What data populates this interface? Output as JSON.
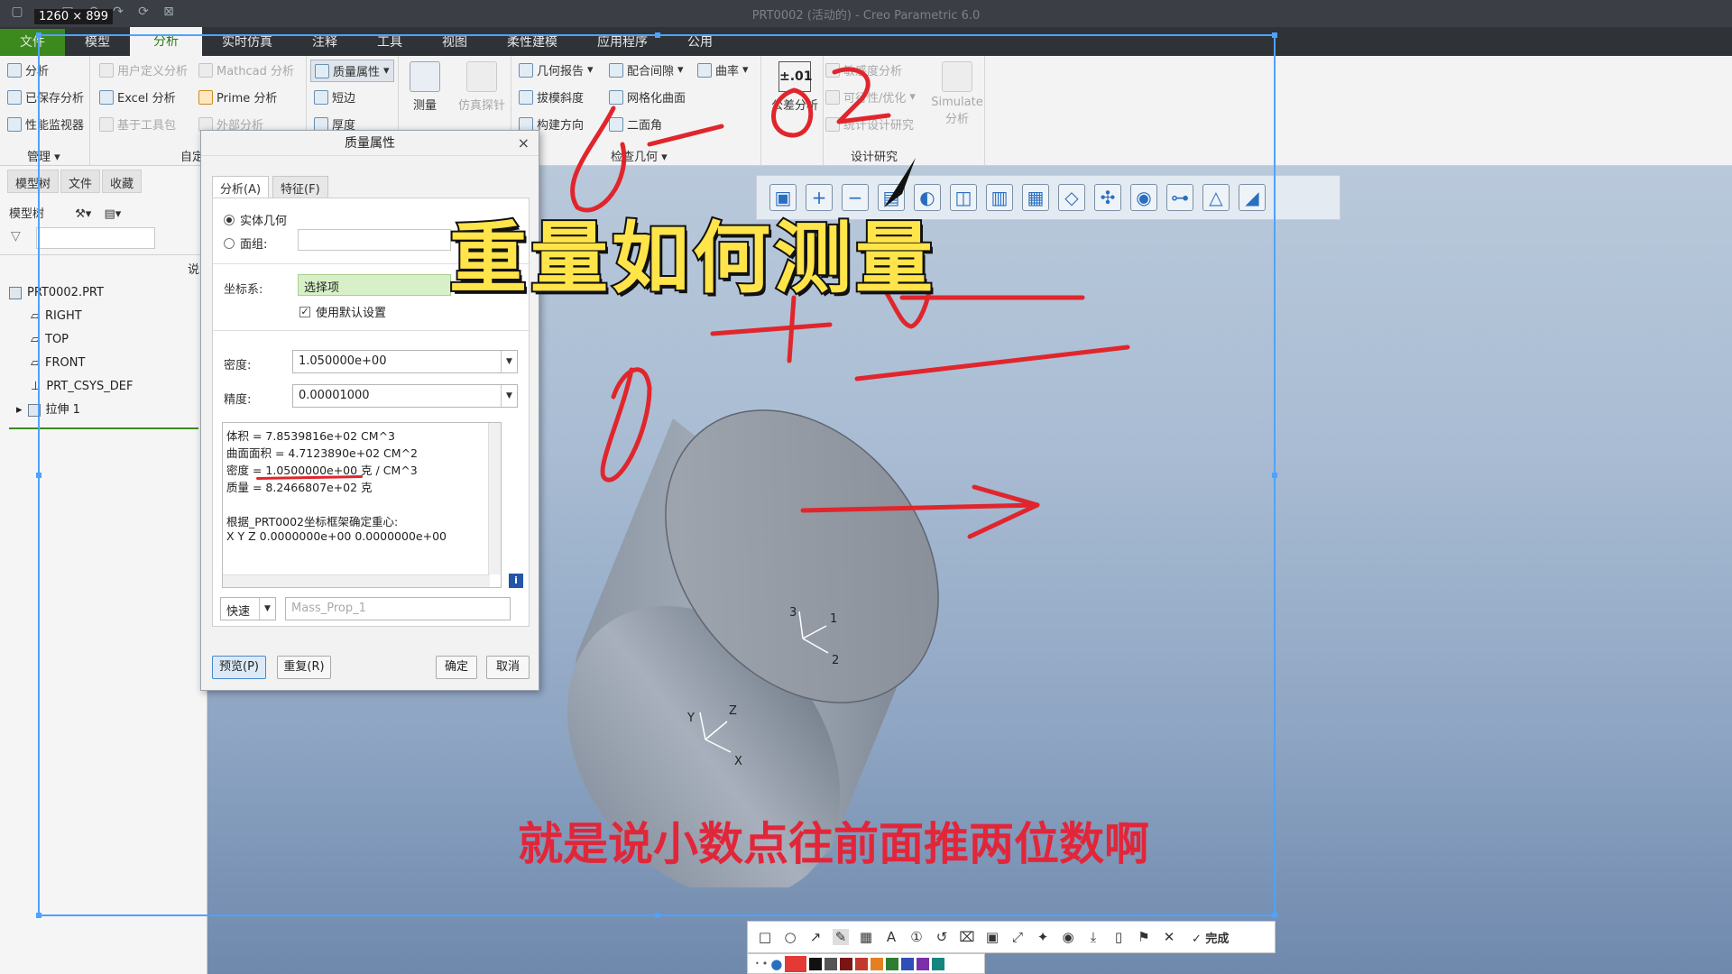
{
  "window": {
    "size_badge": "1260 × 899",
    "title": "PRT0002 (活动的) - Creo Parametric 6.0"
  },
  "tabs": [
    "文件",
    "模型",
    "分析",
    "实时仿真",
    "注释",
    "工具",
    "视图",
    "柔性建模",
    "应用程序",
    "公用"
  ],
  "active_tab": "分析",
  "ribbon": {
    "manage": {
      "items": [
        "分析",
        "已保存分析",
        "性能监视器"
      ],
      "label": "管理"
    },
    "custom": {
      "items": [
        "用户定义分析",
        "Mathcad 分析",
        "Excel 分析",
        "Prime 分析",
        "基于工具包",
        "外部分析"
      ],
      "label": "自定"
    },
    "model_report": {
      "items": [
        "质量属性",
        "短边",
        "厚度"
      ]
    },
    "measure": {
      "label": "测量"
    },
    "sim_probe": {
      "label": "仿真探针"
    },
    "inspect_geometry": {
      "items": [
        "几何报告",
        "配合间隙",
        "曲率",
        "拔模斜度",
        "网格化曲面",
        "构建方向",
        "二面角"
      ],
      "label": "检查几何"
    },
    "tolerance": {
      "icon_text": "±.01",
      "label": "公差分析"
    },
    "design_study": {
      "items": [
        "敏感度分析",
        "可行性/优化",
        "统计设计研究"
      ],
      "simulate": "Simulate 分析",
      "label": "设计研究"
    }
  },
  "left_panel": {
    "tabs": [
      "模型树",
      "文件",
      "收藏"
    ],
    "toolbar_label": "模型树",
    "column_label": "说",
    "tree": [
      {
        "label": "PRT0002.PRT",
        "indent": 0
      },
      {
        "label": "RIGHT",
        "indent": 1
      },
      {
        "label": "TOP",
        "indent": 1
      },
      {
        "label": "FRONT",
        "indent": 1
      },
      {
        "label": "PRT_CSYS_DEF",
        "indent": 1
      },
      {
        "label": "拉伸 1",
        "indent": 1
      }
    ]
  },
  "dialog": {
    "title": "质量属性",
    "tabs": [
      "分析(A)",
      "特征(F)"
    ],
    "active_tab": "分析(A)",
    "radio_solid": "实体几何",
    "radio_quilt": "面组:",
    "csys_label": "坐标系:",
    "csys_value": "选择项",
    "use_default": "使用默认设置",
    "density_label": "密度:",
    "density_value": "1.050000e+00",
    "accuracy_label": "精度:",
    "accuracy_value": "0.00001000",
    "results": [
      "体积 =  7.8539816e+02  CM^3",
      "曲面面积 =  4.7123890e+02  CM^2",
      "密度 =  1.0500000e+00 克 / CM^3",
      "质量 =  8.2466807e+02 克",
      "",
      "根据_PRT0002坐标框架确定重心:",
      "X   Y   Z     0.0000000e+00   0.0000000e+00"
    ],
    "mode": "快速",
    "name_placeholder": "Mass_Prop_1",
    "preview": "预览(P)",
    "repeat": "重复(R)",
    "ok": "确定",
    "cancel": "取消"
  },
  "overlay": {
    "title": "重量如何测量",
    "subtitle": "就是说小数点往前面推两位数啊",
    "title_color": "#ffe44a",
    "subtitle_color": "#e2263a"
  },
  "annotation_toolbar": {
    "tools": [
      "□",
      "○",
      "↗",
      "✎",
      "▦",
      "A",
      "①",
      "↺",
      "⌧",
      "▣",
      "⤢",
      "✦",
      "◉",
      "⤓",
      "▯",
      "⚑",
      "✕"
    ],
    "done": "完成",
    "colors": [
      "#e53935",
      "#111111",
      "#555555",
      "#7b1515",
      "#c0392b",
      "#e67e22",
      "#2e7d32",
      "#2e4fb5",
      "#7b2fa8",
      "#14867d"
    ]
  },
  "axes_labels": {
    "face": [
      "3",
      "1",
      "2"
    ],
    "base": [
      "Y",
      "Z",
      "X"
    ]
  }
}
